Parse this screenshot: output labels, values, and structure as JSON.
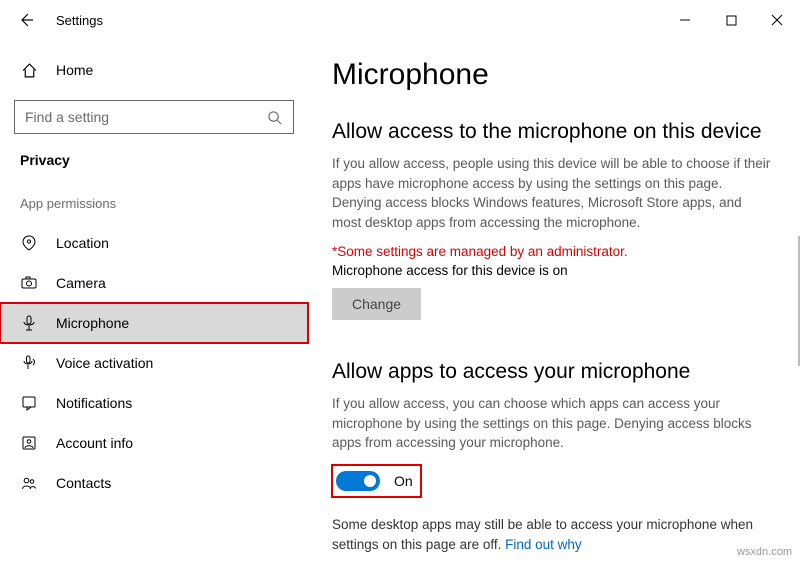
{
  "titlebar": {
    "title": "Settings"
  },
  "sidebar": {
    "home_label": "Home",
    "search_placeholder": "Find a setting",
    "category": "Privacy",
    "section": "App permissions",
    "items": [
      {
        "label": "Location"
      },
      {
        "label": "Camera"
      },
      {
        "label": "Microphone"
      },
      {
        "label": "Voice activation"
      },
      {
        "label": "Notifications"
      },
      {
        "label": "Account info"
      },
      {
        "label": "Contacts"
      }
    ]
  },
  "main": {
    "page_title": "Microphone",
    "section1": {
      "heading": "Allow access to the microphone on this device",
      "desc": "If you allow access, people using this device will be able to choose if their apps have microphone access by using the settings on this page. Denying access blocks Windows features, Microsoft Store apps, and most desktop apps from accessing the microphone.",
      "warning": "*Some settings are managed by an administrator.",
      "status": "Microphone access for this device is on",
      "button": "Change"
    },
    "section2": {
      "heading": "Allow apps to access your microphone",
      "desc": "If you allow access, you can choose which apps can access your microphone by using the settings on this page. Denying access blocks apps from accessing your microphone.",
      "toggle_state": "On",
      "footnote_text": "Some desktop apps may still be able to access your microphone when settings on this page are off. ",
      "footnote_link": "Find out why"
    }
  },
  "watermark": "wsxdn.com"
}
